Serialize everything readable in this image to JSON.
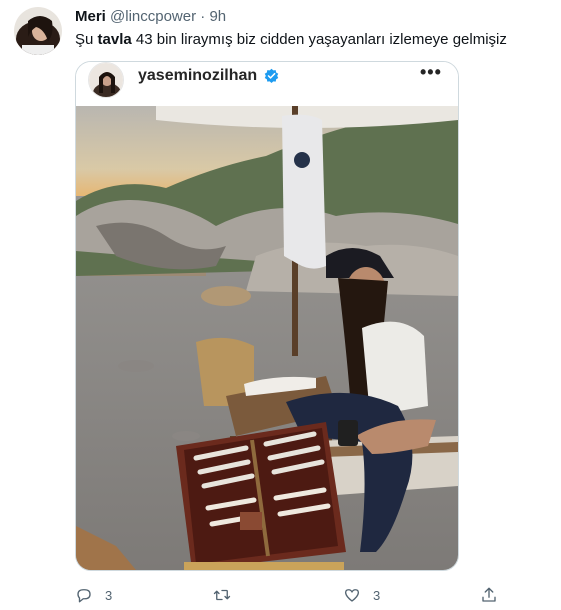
{
  "tweet": {
    "author_name": "Meri",
    "author_handle": "@linccpower",
    "separator": "·",
    "time": "9h",
    "text_before": "Şu ",
    "text_bold": "tavla",
    "text_after": " 43 bin liraymış biz cidden yaşayanları izlemeye gelmişiz"
  },
  "media": {
    "username": "yaseminozilhan",
    "verified": true,
    "more_label": "•••"
  },
  "actions": {
    "reply_count": "3",
    "retweet_count": "",
    "like_count": "3"
  },
  "icons": [
    "reply-icon",
    "retweet-icon",
    "like-icon",
    "share-icon",
    "verified-badge-icon",
    "more-options-icon"
  ],
  "colors": {
    "text": "#0f1419",
    "secondary": "#536471",
    "border": "#cfd9de",
    "verified": "#1d9bf0"
  }
}
